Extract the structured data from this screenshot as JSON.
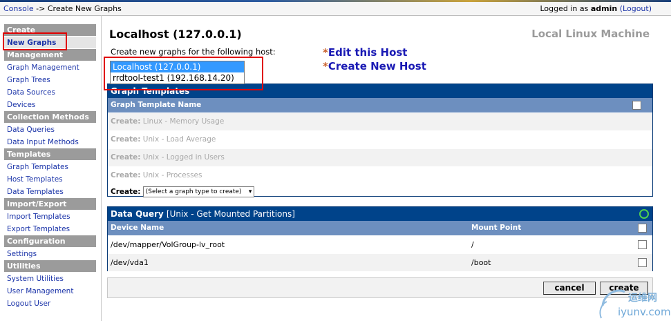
{
  "breadcrumb": {
    "console": "Console",
    "sep": " -> ",
    "current": "Create New Graphs"
  },
  "login": {
    "prefix": "Logged in as ",
    "user": "admin",
    "logout": "(Logout)"
  },
  "sidebar": [
    {
      "type": "head",
      "label": "Create"
    },
    {
      "type": "item",
      "label": "New Graphs",
      "selected": true
    },
    {
      "type": "head",
      "label": "Management"
    },
    {
      "type": "item",
      "label": "Graph Management"
    },
    {
      "type": "item",
      "label": "Graph Trees"
    },
    {
      "type": "item",
      "label": "Data Sources"
    },
    {
      "type": "item",
      "label": "Devices"
    },
    {
      "type": "head",
      "label": "Collection Methods"
    },
    {
      "type": "item",
      "label": "Data Queries"
    },
    {
      "type": "item",
      "label": "Data Input Methods"
    },
    {
      "type": "head",
      "label": "Templates"
    },
    {
      "type": "item",
      "label": "Graph Templates"
    },
    {
      "type": "item",
      "label": "Host Templates"
    },
    {
      "type": "item",
      "label": "Data Templates"
    },
    {
      "type": "head",
      "label": "Import/Export"
    },
    {
      "type": "item",
      "label": "Import Templates"
    },
    {
      "type": "item",
      "label": "Export Templates"
    },
    {
      "type": "head",
      "label": "Configuration"
    },
    {
      "type": "item",
      "label": "Settings"
    },
    {
      "type": "head",
      "label": "Utilities"
    },
    {
      "type": "item",
      "label": "System Utilities"
    },
    {
      "type": "item",
      "label": "User Management"
    },
    {
      "type": "item",
      "label": "Logout User"
    }
  ],
  "host": {
    "title": "Localhost (127.0.0.1)",
    "type": "Local Linux Machine",
    "create_for": "Create new graphs for the following host:"
  },
  "links": {
    "star": "*",
    "edit": "Edit this Host",
    "create": "Create New Host"
  },
  "host_select": {
    "options": [
      "Localhost (127.0.0.1)",
      "rrdtool-test1 (192.168.14.20)"
    ],
    "selected_index": 0
  },
  "graph_templates": {
    "title": "Graph Templates",
    "col_name": "Graph Template Name",
    "rows": [
      {
        "prefix": "Create:",
        "name": " Linux - Memory Usage"
      },
      {
        "prefix": "Create:",
        "name": " Unix - Load Average"
      },
      {
        "prefix": "Create:",
        "name": " Unix - Logged in Users"
      },
      {
        "prefix": "Create:",
        "name": " Unix - Processes"
      }
    ],
    "create_label": "Create:",
    "select_placeholder": "(Select a graph type to create)"
  },
  "data_query": {
    "title": "Data Query",
    "query": "[Unix - Get Mounted Partitions]",
    "col_device": "Device Name",
    "col_mount": "Mount Point",
    "rows": [
      {
        "device": "/dev/mapper/VolGroup-lv_root",
        "mount": "/"
      },
      {
        "device": "/dev/vda1",
        "mount": "/boot"
      }
    ]
  },
  "buttons": {
    "cancel": "cancel",
    "create": "create"
  },
  "watermark": {
    "line1": "运维网",
    "line2": "iyunv.com"
  }
}
